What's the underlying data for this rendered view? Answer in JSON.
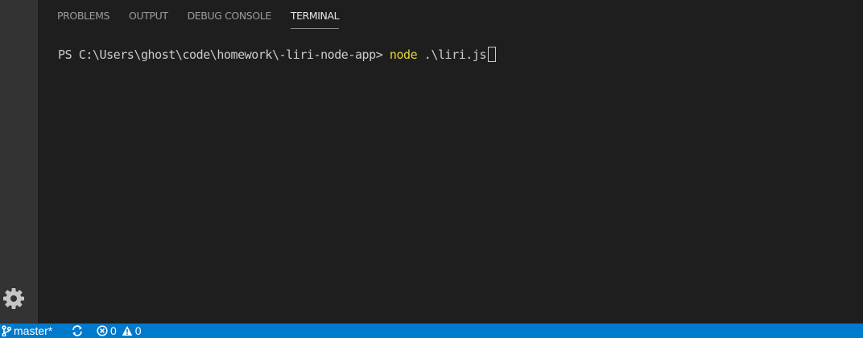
{
  "panel": {
    "tabs": [
      {
        "label": "PROBLEMS"
      },
      {
        "label": "OUTPUT"
      },
      {
        "label": "DEBUG CONSOLE"
      },
      {
        "label": "TERMINAL"
      }
    ],
    "active_tab": "TERMINAL"
  },
  "terminal": {
    "prompt": "PS C:\\Users\\ghost\\code\\homework\\-liri-node-app> ",
    "command": "node",
    "args": " .\\liri.js"
  },
  "activity_bar": {
    "settings_icon": "gear-icon"
  },
  "status_bar": {
    "branch": "master*",
    "branch_icon": "git-branch-icon",
    "sync_icon": "sync-icon",
    "errors": "0",
    "warnings": "0"
  },
  "colors": {
    "status_bar_bg": "#007acc",
    "command": "#e5d33a",
    "terminal_text": "#cccccc",
    "panel_bg": "#1e1e1e",
    "activity_bar_bg": "#333333"
  }
}
